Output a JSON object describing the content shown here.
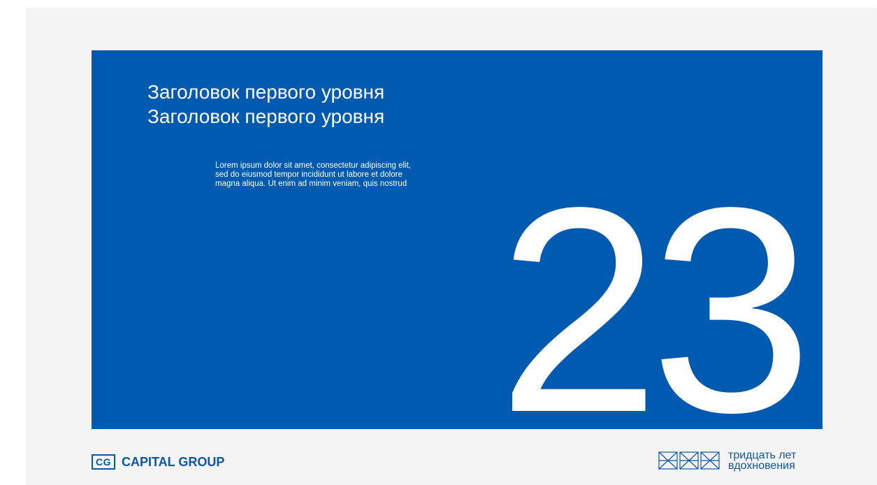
{
  "slide": {
    "accent_color": "#005ab0",
    "heading_lines": [
      "Заголовок первого уровня",
      "Заголовок первого уровня"
    ],
    "body_lines": [
      "Lorem ipsum dolor sit amet, consectetur adipiscing elit,",
      "sed do eiusmod tempor incididunt ut labore et dolore",
      "magna aliqua. Ut enim ad minim veniam, quis nostrud"
    ],
    "big_number": "23"
  },
  "footer": {
    "logo_mark": "CG",
    "company_name": "CAPITAL GROUP",
    "brand_color": "#0a57a8",
    "emblem_icon": "xxx-emblem-icon",
    "tagline_lines": [
      "тридцать лет",
      "вдохновения"
    ]
  }
}
